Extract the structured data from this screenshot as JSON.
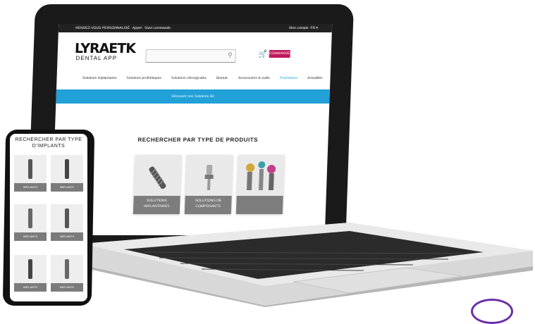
{
  "topbar": {
    "left_text": "RENDEZ-VOUS PERSONNALISÉ · Appel · Suivi commande",
    "account": "Mon compte",
    "language": "FR ▾"
  },
  "header": {
    "logo": "LYRAETK",
    "logo_sub": "DENTAL APP",
    "search_placeholder": "",
    "cart_count": "0",
    "cta_label": "COMMANDER"
  },
  "nav": {
    "items": [
      {
        "label": "Solutions implantaires"
      },
      {
        "label": "Solutions prothétiques"
      },
      {
        "label": "Solutions chirurgicales"
      },
      {
        "label": "Biomat."
      },
      {
        "label": "Accessoires & outils"
      },
      {
        "label": "Promotions"
      },
      {
        "label": "Actualités"
      }
    ]
  },
  "banner": {
    "text": "Découvrir nos Solutions 3D"
  },
  "section": {
    "title": "RECHERCHER PAR TYPE DE PRODUITS",
    "cards": [
      {
        "caption_line1": "SOLUTIONS",
        "caption_line2": "IMPLANTAIRES"
      },
      {
        "caption_line1": "SOLUTIONS DE",
        "caption_line2": "COMPOSANTS"
      },
      {
        "caption_line1": "",
        "caption_line2": ""
      }
    ]
  },
  "phone": {
    "title": "RECHERCHER PAR TYPE D'IMPLANTS",
    "tiles": [
      {
        "label": "IMPLANTS"
      },
      {
        "label": "IMPLANTS"
      },
      {
        "label": "IMPLANTS"
      },
      {
        "label": "IMPLANTS"
      },
      {
        "label": "IMPLANTS"
      },
      {
        "label": "IMPLANTS"
      }
    ]
  },
  "colors": {
    "accent": "#22a0d8",
    "cta": "#c2185b",
    "badge": "#6a2ea8"
  }
}
